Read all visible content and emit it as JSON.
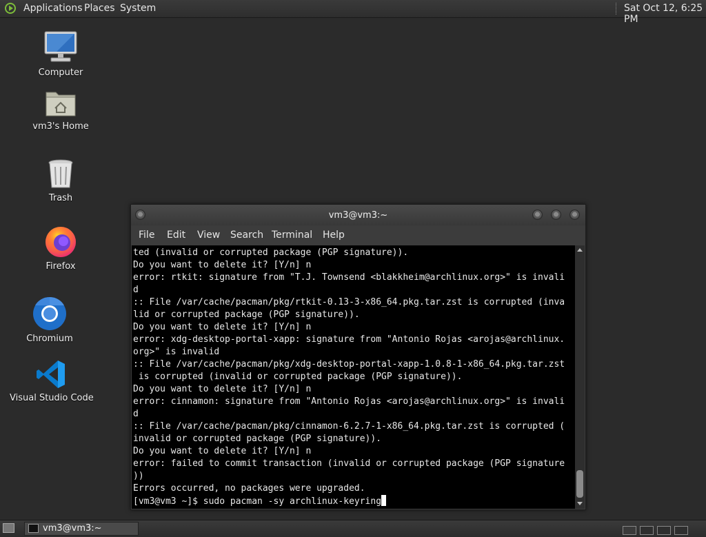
{
  "top_panel": {
    "menus": [
      "Applications",
      "Places",
      "System"
    ],
    "clock": "Sat Oct 12,  6:25 PM"
  },
  "desktop_icons": [
    {
      "label": "Computer",
      "icon": "computer-icon"
    },
    {
      "label": "vm3's Home",
      "icon": "home-folder-icon"
    },
    {
      "label": "Trash",
      "icon": "trash-icon"
    },
    {
      "label": "Firefox",
      "icon": "firefox-icon"
    },
    {
      "label": "Chromium",
      "icon": "chromium-icon"
    },
    {
      "label": "Visual Studio Code",
      "icon": "vscode-icon"
    }
  ],
  "terminal": {
    "title": "vm3@vm3:~",
    "menu": [
      "File",
      "Edit",
      "View",
      "Search",
      "Terminal",
      "Help"
    ],
    "lines": [
      "ted (invalid or corrupted package (PGP signature)).",
      "Do you want to delete it? [Y/n] n",
      "error: rtkit: signature from \"T.J. Townsend <blakkheim@archlinux.org>\" is invali",
      "d",
      ":: File /var/cache/pacman/pkg/rtkit-0.13-3-x86_64.pkg.tar.zst is corrupted (inva",
      "lid or corrupted package (PGP signature)).",
      "Do you want to delete it? [Y/n] n",
      "error: xdg-desktop-portal-xapp: signature from \"Antonio Rojas <arojas@archlinux.",
      "org>\" is invalid",
      ":: File /var/cache/pacman/pkg/xdg-desktop-portal-xapp-1.0.8-1-x86_64.pkg.tar.zst",
      " is corrupted (invalid or corrupted package (PGP signature)).",
      "Do you want to delete it? [Y/n] n",
      "error: cinnamon: signature from \"Antonio Rojas <arojas@archlinux.org>\" is invali",
      "d",
      ":: File /var/cache/pacman/pkg/cinnamon-6.2.7-1-x86_64.pkg.tar.zst is corrupted (",
      "invalid or corrupted package (PGP signature)).",
      "Do you want to delete it? [Y/n] n",
      "error: failed to commit transaction (invalid or corrupted package (PGP signature",
      "))",
      "Errors occurred, no packages were upgraded."
    ],
    "prompt": "[vm3@vm3 ~]$ ",
    "command": "sudo pacman -sy archlinux-keyring"
  },
  "taskbar": {
    "task_label": "vm3@vm3:~"
  },
  "colors": {
    "desktop_bg": "#2b2b2b",
    "terminal_bg": "#000000",
    "terminal_fg": "#e8e8e8",
    "accent_green": "#7dbd3a"
  }
}
